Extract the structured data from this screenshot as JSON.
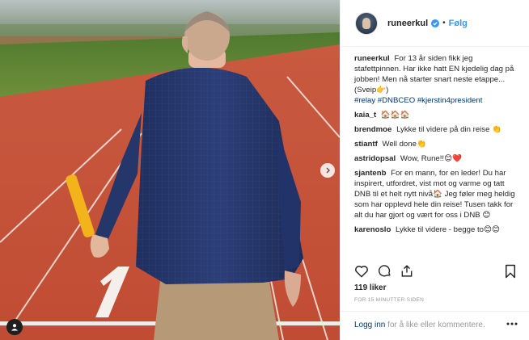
{
  "post": {
    "username": "runeerkul",
    "follow_label": "Følg",
    "separator": "•",
    "caption": {
      "username": "runeerkul",
      "text": "For 13 år siden fikk jeg stafettpinnen. Har ikke hatt EN kjedelig dag på jobben! Men nå starter snart neste etappe... (Sveip👉)",
      "hashtags": "#relay #DNBCEO #kjerstin4president"
    },
    "comments": [
      {
        "username": "kaia_t",
        "text": "🏠🏠🏠"
      },
      {
        "username": "brendmoe",
        "text": "Lykke til videre på din reise 👏"
      },
      {
        "username": "stiantf",
        "text": "Well done👏"
      },
      {
        "username": "astridopsal",
        "text": "Wow, Rune!!😊❤️"
      },
      {
        "username": "sjantenb",
        "text": "For en mann, for en leder! Du har inspirert, utfordret, vist mot og varme og tatt DNB til et helt nytt nivå🏠 Jeg føler meg heldig som har opplevd hele din reise! Tusen takk for alt du har gjort og vært for oss i DNB 😊"
      },
      {
        "username": "karenoslo",
        "text": "Lykke til videre - begge to😊😊"
      }
    ],
    "likes": "119 liker",
    "timestamp": "FOR 15 MINUTTER SIDEN",
    "login_link": "Logg inn",
    "login_rest": "for å like eller kommentere."
  },
  "icons": {
    "verified": "verified-badge-icon",
    "like": "heart-icon",
    "comment": "comment-icon",
    "share": "share-icon",
    "save": "bookmark-icon",
    "more": "more-options-icon",
    "next": "chevron-right-icon",
    "tag": "user-tag-icon"
  },
  "colors": {
    "link": "#3897f0",
    "hashtag": "#003569",
    "track": "#c8553b"
  }
}
